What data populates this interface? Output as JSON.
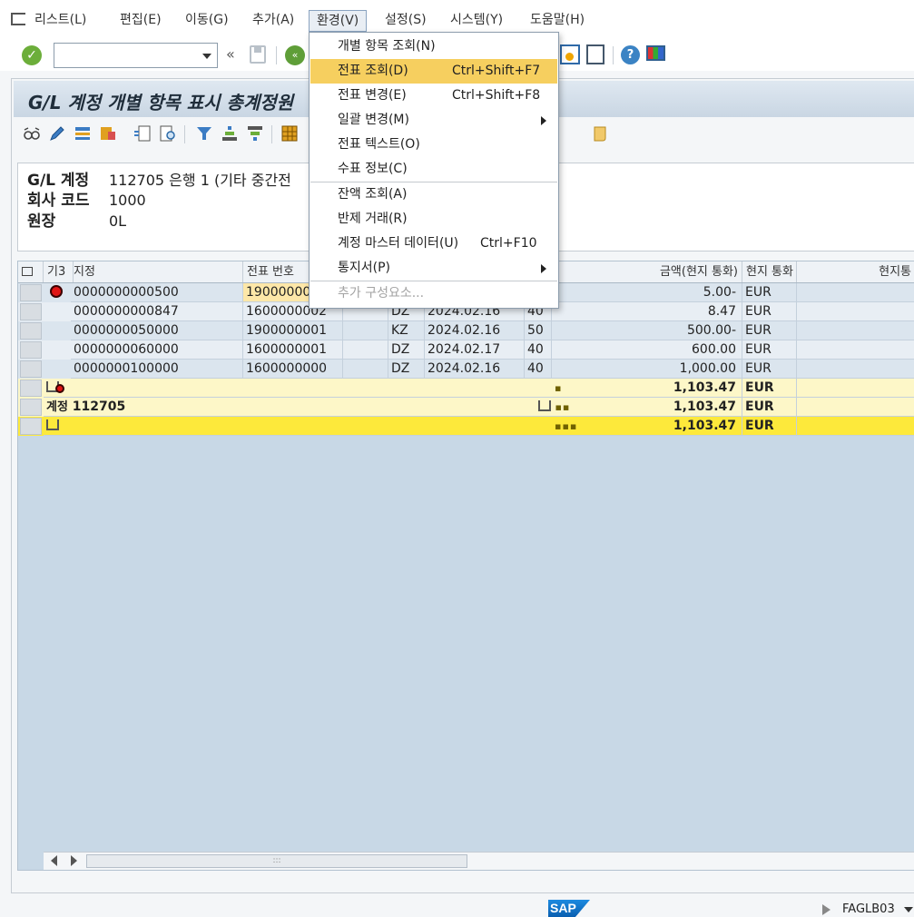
{
  "menubar": {
    "items": [
      {
        "label": "리스트(L)"
      },
      {
        "label": "편집(E)"
      },
      {
        "label": "이동(G)"
      },
      {
        "label": "추가(A)"
      },
      {
        "label": "환경(V)"
      },
      {
        "label": "설정(S)"
      },
      {
        "label": "시스템(Y)"
      },
      {
        "label": "도움말(H)"
      }
    ]
  },
  "toolbar": {
    "command_value": "",
    "back_glyph": "«"
  },
  "title": "G/L 계정 개별 항목 표시 총계정원",
  "header": {
    "account_label": "G/L 계정",
    "account_value": "112705 은행 1 (기타 중간전",
    "company_label": "회사 코드",
    "company_value": "1000",
    "ledger_label": "원장",
    "ledger_value": "0L"
  },
  "columns": {
    "c1": "기3",
    "c2": "지정",
    "c3": "전표 번호",
    "amount": "금액(현지 통화)",
    "currency": "현지 통화",
    "last": "현지통"
  },
  "rows": [
    {
      "assignment": "0000000000500",
      "doc": "190000000",
      "type": "",
      "date": "",
      "pk": "",
      "amount": "5.00-",
      "cur": "EUR"
    },
    {
      "assignment": "0000000000847",
      "doc": "1600000002",
      "type": "DZ",
      "date": "2024.02.16",
      "pk": "40",
      "amount": "8.47",
      "cur": "EUR"
    },
    {
      "assignment": "0000000050000",
      "doc": "1900000001",
      "type": "KZ",
      "date": "2024.02.16",
      "pk": "50",
      "amount": "500.00-",
      "cur": "EUR"
    },
    {
      "assignment": "0000000060000",
      "doc": "1600000001",
      "type": "DZ",
      "date": "2024.02.17",
      "pk": "40",
      "amount": "600.00",
      "cur": "EUR"
    },
    {
      "assignment": "0000000100000",
      "doc": "1600000000",
      "type": "DZ",
      "date": "2024.02.16",
      "pk": "40",
      "amount": "1,000.00",
      "cur": "EUR"
    }
  ],
  "subtotal": {
    "amount": "1,103.47",
    "cur": "EUR",
    "marker": "▪"
  },
  "account_total": {
    "label": "계정",
    "account": "112705",
    "amount": "1,103.47",
    "cur": "EUR",
    "marker": "▪▪"
  },
  "grand_total": {
    "amount": "1,103.47",
    "cur": "EUR",
    "marker": "▪▪▪"
  },
  "dropdown": {
    "items": [
      {
        "label": "개별 항목 조회(N)",
        "shortcut": ""
      },
      {
        "label": "전표 조회(D)",
        "shortcut": "Ctrl+Shift+F7"
      },
      {
        "label": "전표 변경(E)",
        "shortcut": "Ctrl+Shift+F8"
      },
      {
        "label": "일괄 변경(M)",
        "shortcut": ""
      },
      {
        "label": "전표 텍스트(O)",
        "shortcut": ""
      },
      {
        "label": "수표 정보(C)",
        "shortcut": ""
      },
      {
        "label": "잔액 조회(A)",
        "shortcut": ""
      },
      {
        "label": "반제 거래(R)",
        "shortcut": ""
      },
      {
        "label": "계정 마스터 데이터(U)",
        "shortcut": "Ctrl+F10"
      },
      {
        "label": "통지서(P)",
        "shortcut": ""
      },
      {
        "label": "추가 구성요소...",
        "shortcut": ""
      }
    ]
  },
  "status": {
    "sap_logo": "SAP",
    "tx_code": "FAGLB03"
  },
  "colors": {
    "highlight": "#f6cf5f",
    "total_yellow": "#fde93b",
    "subtotal_yellow": "#fdf7c8",
    "grid_bg": "#c8d8e6"
  }
}
